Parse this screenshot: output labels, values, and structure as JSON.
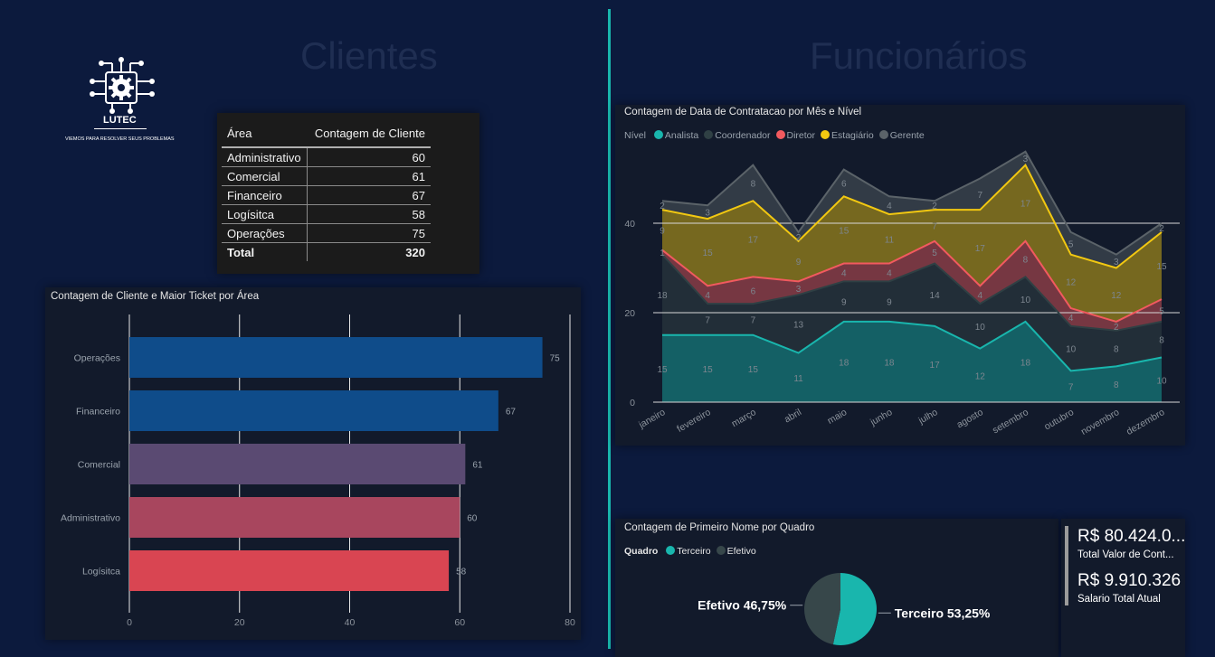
{
  "sections": {
    "clientes_title": "Clientes",
    "funcionarios_title": "Funcionários"
  },
  "logo": {
    "name": "LUTEC",
    "tagline": "VIEMOS PARA RESOLVER SEUS PROBLEMAS"
  },
  "colors": {
    "background": "#0c1a3d",
    "accent": "#19b6ad",
    "panel": "#121a2b"
  },
  "client_table": {
    "headers": [
      "Área",
      "Contagem de Cliente"
    ],
    "rows": [
      [
        "Administrativo",
        "60"
      ],
      [
        "Comercial",
        "61"
      ],
      [
        "Financeiro",
        "67"
      ],
      [
        "Logísitca",
        "58"
      ],
      [
        "Operações",
        "75"
      ]
    ],
    "total": [
      "Total",
      "320"
    ]
  },
  "bar_chart": {
    "title": "Contagem de Cliente e Maior Ticket por Área"
  },
  "area_chart": {
    "title": "Contagem de Data de Contratacao por Mês e Nível",
    "legend_label": "Nível"
  },
  "pie_chart": {
    "title": "Contagem de Primeiro Nome por Quadro",
    "legend_label": "Quadro"
  },
  "kpis": [
    {
      "value": "R$ 80.424.0...",
      "label": "Total Valor de Cont..."
    },
    {
      "value": "R$ 9.910.326",
      "label": "Salario Total Atual"
    }
  ],
  "chart_data": [
    {
      "type": "bar",
      "title": "Contagem de Cliente e Maior Ticket por Área",
      "categories": [
        "Operações",
        "Financeiro",
        "Comercial",
        "Administrativo",
        "Logísitca"
      ],
      "values": [
        75,
        67,
        61,
        60,
        58
      ],
      "colors": [
        "#0f4c8a",
        "#0f4c8a",
        "#5a4a72",
        "#a8465e",
        "#d94552"
      ],
      "xlim": [
        0,
        80
      ],
      "xticks": [
        0,
        20,
        40,
        60,
        80
      ],
      "grid": true
    },
    {
      "type": "area",
      "stacked": true,
      "title": "Contagem de Data de Contratacao por Mês e Nível",
      "categories": [
        "janeiro",
        "fevereiro",
        "março",
        "abril",
        "maio",
        "junho",
        "julho",
        "agosto",
        "setembro",
        "outubro",
        "novembro",
        "dezembro"
      ],
      "series": [
        {
          "name": "Analista",
          "color": "#19b6ad",
          "values": [
            15,
            15,
            15,
            11,
            18,
            18,
            17,
            12,
            18,
            7,
            8,
            10
          ]
        },
        {
          "name": "Coordenador",
          "color": "#2f4044",
          "values": [
            18,
            7,
            7,
            13,
            9,
            9,
            14,
            10,
            10,
            10,
            8,
            8
          ]
        },
        {
          "name": "Diretor",
          "color": "#f25a5f",
          "values": [
            1,
            4,
            6,
            3,
            4,
            4,
            5,
            4,
            8,
            4,
            2,
            5
          ]
        },
        {
          "name": "Estagiário",
          "color": "#f2c811",
          "values": [
            9,
            15,
            17,
            9,
            15,
            11,
            7,
            17,
            17,
            12,
            12,
            15
          ]
        },
        {
          "name": "Gerente",
          "color": "#5b6369",
          "values": [
            2,
            3,
            8,
            2,
            6,
            4,
            2,
            7,
            3,
            5,
            3,
            2
          ]
        }
      ],
      "ylim": [
        0,
        55
      ],
      "yticks": [
        0,
        20,
        40
      ],
      "grid": true,
      "legend_position": "top-left"
    },
    {
      "type": "pie",
      "title": "Contagem de Primeiro Nome por Quadro",
      "slices": [
        {
          "name": "Terceiro",
          "value": 53.25,
          "label": "Terceiro 53,25%",
          "color": "#19b6ad"
        },
        {
          "name": "Efetivo",
          "value": 46.75,
          "label": "Efetivo 46,75%",
          "color": "#37474a"
        }
      ]
    }
  ]
}
